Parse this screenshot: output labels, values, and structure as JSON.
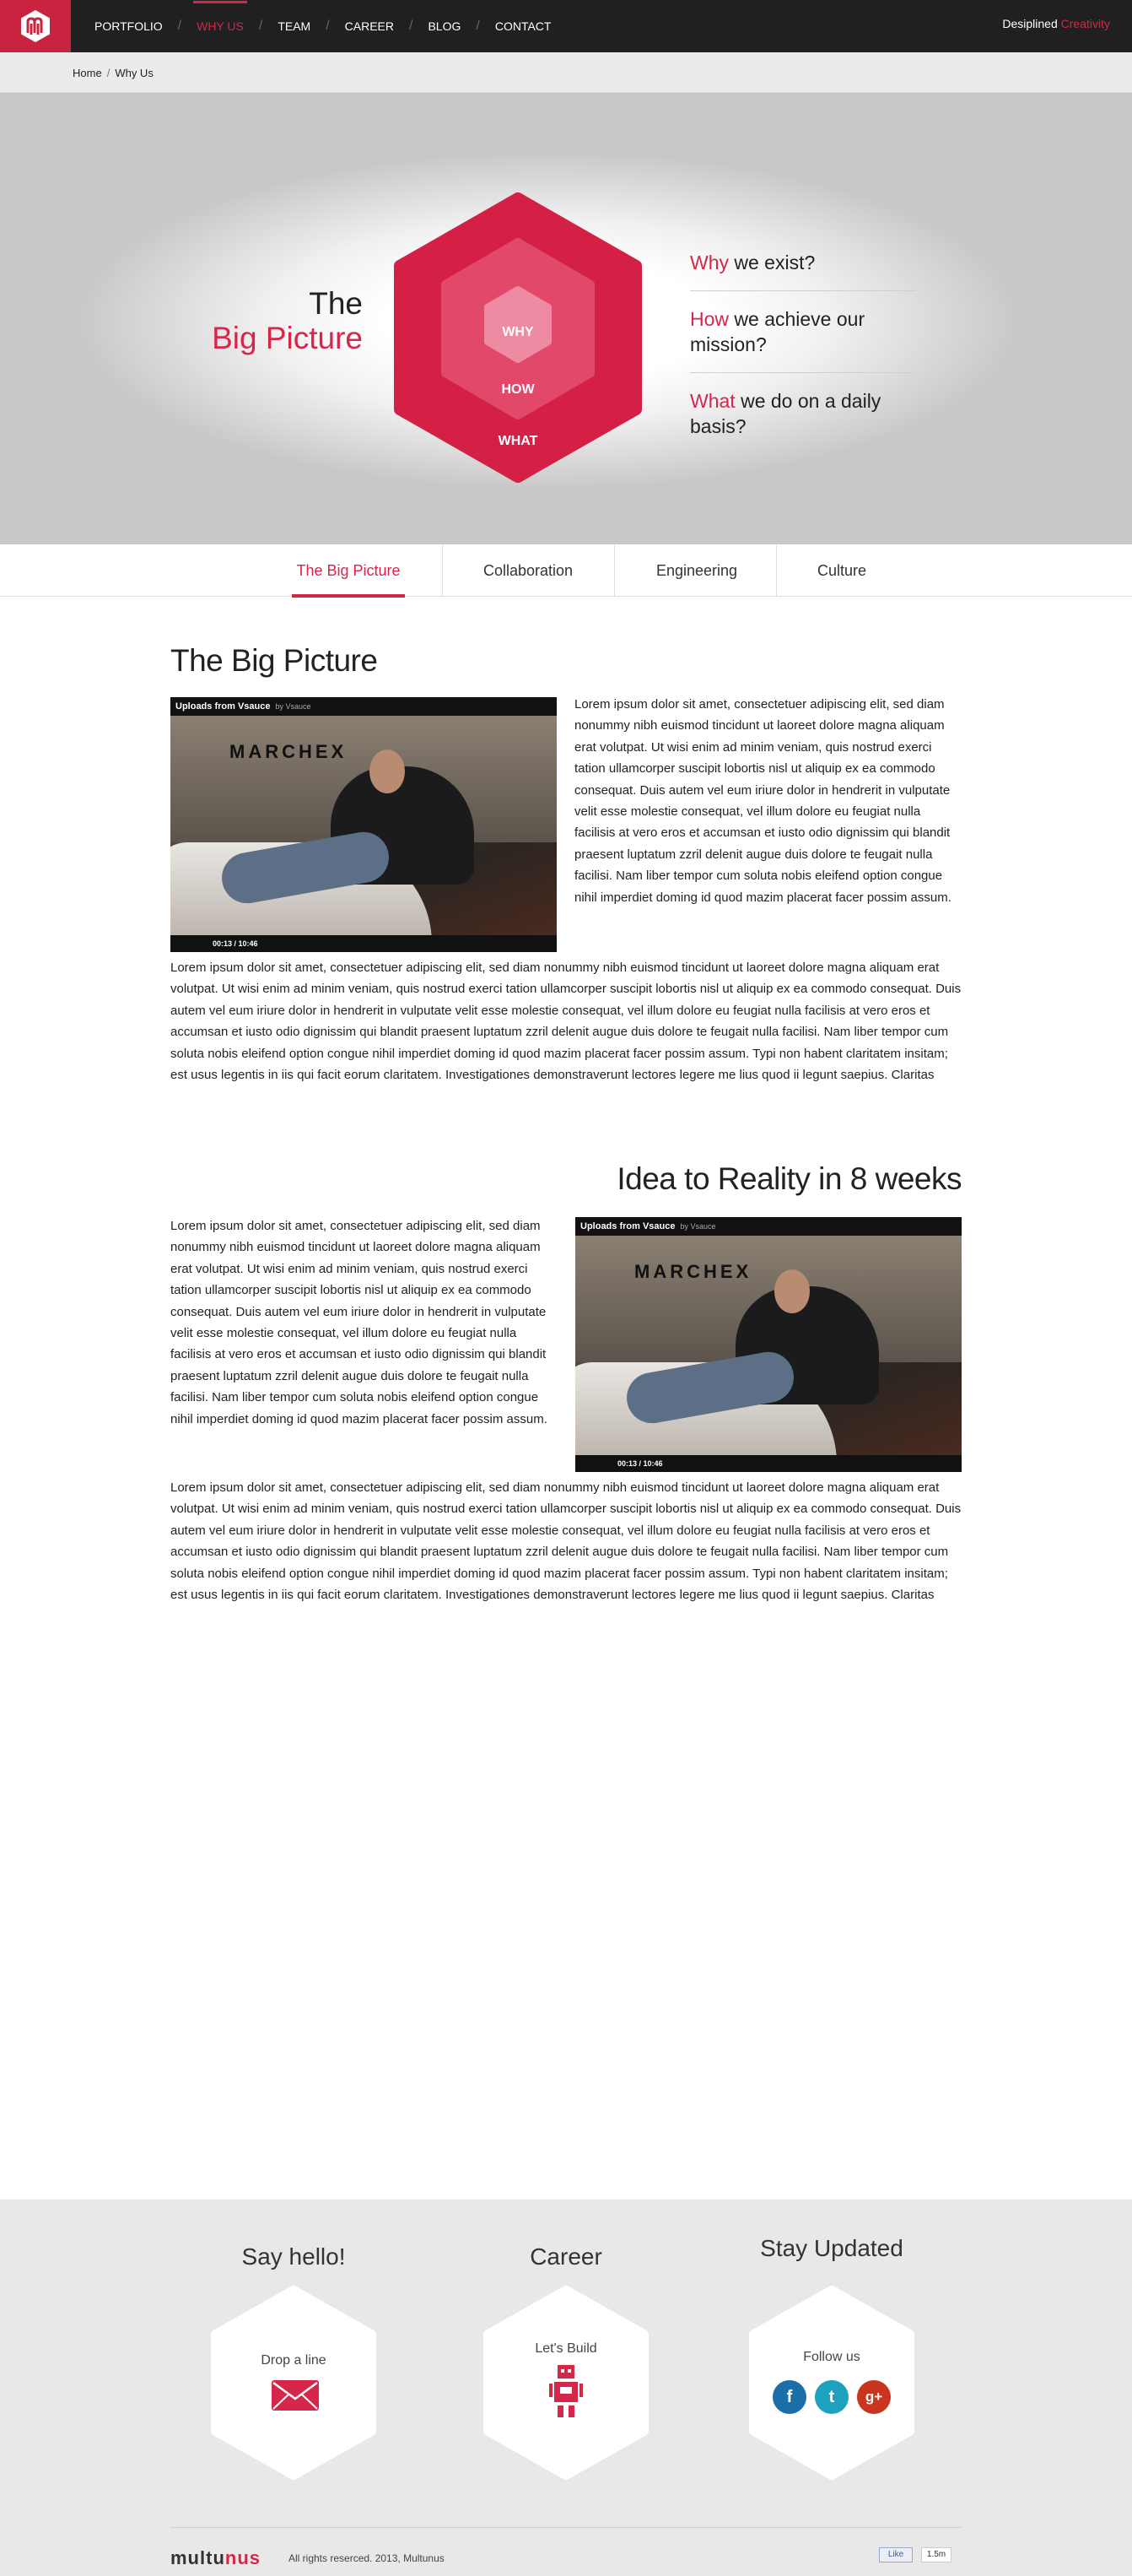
{
  "nav": {
    "items": [
      "PORTFOLIO",
      "WHY US",
      "TEAM",
      "CAREER",
      "BLOG",
      "CONTACT"
    ],
    "active": "WHY US",
    "tagline_a": "Desiplined",
    "tagline_b": "Creativity"
  },
  "breadcrumb": {
    "home": "Home",
    "current": "Why Us"
  },
  "hero": {
    "title_line1": "The",
    "title_line2": "Big Picture",
    "hex_labels": {
      "inner": "WHY",
      "middle": "HOW",
      "outer": "WHAT"
    },
    "questions": [
      {
        "accent": "Why",
        "rest": " we exist?"
      },
      {
        "accent": "How",
        "rest": " we achieve our mission?"
      },
      {
        "accent": "What",
        "rest": " we do on a daily basis?"
      }
    ]
  },
  "tabs": [
    "The Big Picture",
    "Collaboration",
    "Engineering",
    "Culture"
  ],
  "section1": {
    "title": "The Big Picture",
    "side_text": "Lorem ipsum dolor sit amet, consectetuer adipiscing elit, sed diam nonummy nibh euismod tincidunt ut laoreet dolore magna aliquam erat volutpat. Ut wisi enim ad minim veniam, quis nostrud exerci tation ullamcorper suscipit lobortis nisl ut aliquip ex ea commodo consequat. Duis autem vel eum iriure dolor in hendrerit in vulputate velit esse molestie consequat, vel illum dolore eu feugiat nulla facilisis at vero eros et accumsan et iusto odio dignissim qui blandit praesent luptatum zzril delenit augue duis dolore te feugait nulla facilisi. Nam liber tempor cum soluta nobis eleifend option congue nihil imperdiet doming id quod mazim placerat facer possim assum.",
    "full_text": "Lorem ipsum dolor sit amet, consectetuer adipiscing elit, sed diam nonummy nibh euismod tincidunt ut laoreet dolore magna aliquam erat volutpat. Ut wisi enim ad minim veniam, quis nostrud exerci tation ullamcorper suscipit lobortis nisl ut aliquip ex ea commodo consequat. Duis autem vel eum iriure dolor in hendrerit in vulputate velit esse molestie consequat, vel illum dolore eu feugiat nulla facilisis at vero eros et accumsan et iusto odio dignissim qui blandit praesent luptatum zzril delenit augue duis dolore te feugait nulla facilisi. Nam liber tempor cum soluta nobis eleifend option congue nihil imperdiet doming id quod mazim placerat facer possim assum. Typi non habent claritatem insitam; est usus legentis in iis qui facit eorum claritatem. Investigationes demonstraverunt lectores legere me lius quod ii legunt saepius. Claritas",
    "video": {
      "channel": "Uploads from Vsauce",
      "by": "by Vsauce",
      "brand": "MARCHEX",
      "time": "00:13 / 10:46"
    }
  },
  "section2": {
    "title": "Idea to Reality in 8 weeks",
    "side_text": "Lorem ipsum dolor sit amet, consectetuer adipiscing elit, sed diam nonummy nibh euismod tincidunt ut laoreet dolore magna aliquam erat volutpat. Ut wisi enim ad minim veniam, quis nostrud exerci tation ullamcorper suscipit lobortis nisl ut aliquip ex ea commodo consequat. Duis autem vel eum iriure dolor in hendrerit in vulputate velit esse molestie consequat, vel illum dolore eu feugiat nulla facilisis at vero eros et accumsan et iusto odio dignissim qui blandit praesent luptatum zzril delenit augue duis dolore te feugait nulla facilisi. Nam liber tempor cum soluta nobis eleifend option congue nihil imperdiet doming id quod mazim placerat facer possim assum.",
    "full_text": "Lorem ipsum dolor sit amet, consectetuer adipiscing elit, sed diam nonummy nibh euismod tincidunt ut laoreet dolore magna aliquam erat volutpat. Ut wisi enim ad minim veniam, quis nostrud exerci tation ullamcorper suscipit lobortis nisl ut aliquip ex ea commodo consequat. Duis autem vel eum iriure dolor in hendrerit in vulputate velit esse molestie consequat, vel illum dolore eu feugiat nulla facilisis at vero eros et accumsan et iusto odio dignissim qui blandit praesent luptatum zzril delenit augue duis dolore te feugait nulla facilisi. Nam liber tempor cum soluta nobis eleifend option congue nihil imperdiet doming id quod mazim placerat facer possim assum. Typi non habent claritatem insitam; est usus legentis in iis qui facit eorum claritatem. Investigationes demonstraverunt lectores legere me lius quod ii legunt saepius. Claritas",
    "video": {
      "channel": "Uploads from Vsauce",
      "by": "by Vsauce",
      "brand": "MARCHEX",
      "time": "00:13 / 10:46"
    }
  },
  "footer": {
    "col1": {
      "title": "Say hello!",
      "label": "Drop a line",
      "icon": "envelope-icon"
    },
    "col2": {
      "title": "Career",
      "label": "Let's Build",
      "icon": "robot-icon"
    },
    "col3": {
      "title": "Stay Updated",
      "label": "Follow us",
      "icons": [
        "facebook-icon",
        "twitter-icon",
        "google-plus-icon"
      ]
    },
    "brand_a": "multu",
    "brand_b": "nus",
    "copyright": "All rights reserced. 2013, Multunus",
    "like": "Like",
    "like_count": "1.5m",
    "social_glyphs": [
      "f",
      "t",
      "g+"
    ]
  },
  "colors": {
    "accent": "#d6264a",
    "dark": "#202020",
    "hex_outer": "#d42045",
    "hex_middle": "#e2486a",
    "hex_inner": "#ee8aa2"
  }
}
